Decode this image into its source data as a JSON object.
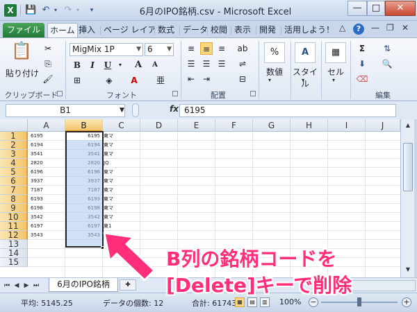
{
  "window": {
    "title": "6月のIPO銘柄.csv  -  Microsoft Excel",
    "logo": "X",
    "qat": {
      "save_icon": "save-icon",
      "undo_icon": "undo-icon",
      "redo_icon": "redo-icon"
    },
    "controls": {
      "minimize": "—",
      "maximize": "□",
      "close": "✕"
    }
  },
  "ribbon": {
    "tabs": [
      "ファイル",
      "ホーム",
      "挿入",
      "ページ レイアウト",
      "数式",
      "データ",
      "校閲",
      "表示",
      "開発",
      "活用しよう！"
    ],
    "active_tab": "ホーム",
    "help": "?",
    "clipboard": {
      "paste_label": "貼り付け",
      "group_label": "クリップボード"
    },
    "font": {
      "name": "MigMix 1P",
      "size": "6",
      "bold": "B",
      "italic": "I",
      "underline": "U",
      "grow": "A",
      "shrink": "A",
      "group_label": "フォント"
    },
    "alignment": {
      "group_label": "配置"
    },
    "number": {
      "percent": "%",
      "label": "数値"
    },
    "styles": {
      "label": "スタイル"
    },
    "cells": {
      "label": "セル"
    },
    "editing": {
      "sum": "Σ",
      "group_label": "編集"
    }
  },
  "formula_bar": {
    "name_box": "B1",
    "fx": "fx",
    "value": "6195"
  },
  "grid": {
    "columns": [
      "A",
      "B",
      "C",
      "D",
      "E",
      "F",
      "G",
      "H",
      "I",
      "J"
    ],
    "selected_column": "B",
    "rows": [
      {
        "n": "1",
        "a": "6195",
        "b": "6195",
        "c": "東マ"
      },
      {
        "n": "2",
        "a": "6194",
        "b": "6194",
        "c": "東マ"
      },
      {
        "n": "3",
        "a": "3541",
        "b": "3541",
        "c": "東マ"
      },
      {
        "n": "4",
        "a": "2820",
        "b": "2820",
        "c": "JQ"
      },
      {
        "n": "5",
        "a": "6196",
        "b": "6196",
        "c": "東マ"
      },
      {
        "n": "6",
        "a": "3937",
        "b": "3937",
        "c": "東マ"
      },
      {
        "n": "7",
        "a": "7187",
        "b": "7187",
        "c": "東マ"
      },
      {
        "n": "8",
        "a": "6193",
        "b": "6193",
        "c": "東マ"
      },
      {
        "n": "9",
        "a": "6198",
        "b": "6198",
        "c": "東マ"
      },
      {
        "n": "10",
        "a": "3542",
        "b": "3542",
        "c": "東マ"
      },
      {
        "n": "11",
        "a": "6197",
        "b": "6197",
        "c": "東1"
      },
      {
        "n": "12",
        "a": "3543",
        "b": "3543",
        "c": "東1"
      },
      {
        "n": "13",
        "a": "",
        "b": "",
        "c": ""
      },
      {
        "n": "14",
        "a": "",
        "b": "",
        "c": ""
      },
      {
        "n": "15",
        "a": "",
        "b": "",
        "c": ""
      }
    ]
  },
  "sheet_tabs": {
    "active": "6月のIPO銘柄"
  },
  "status_bar": {
    "average": "平均: 5145.25",
    "count": "データの個数: 12",
    "sum": "合計: 61743",
    "zoom": "100%"
  },
  "annotation": {
    "line1": "B列の銘柄コードを",
    "line2": "[Delete]キーで削除",
    "color": "#ff2d7a"
  }
}
